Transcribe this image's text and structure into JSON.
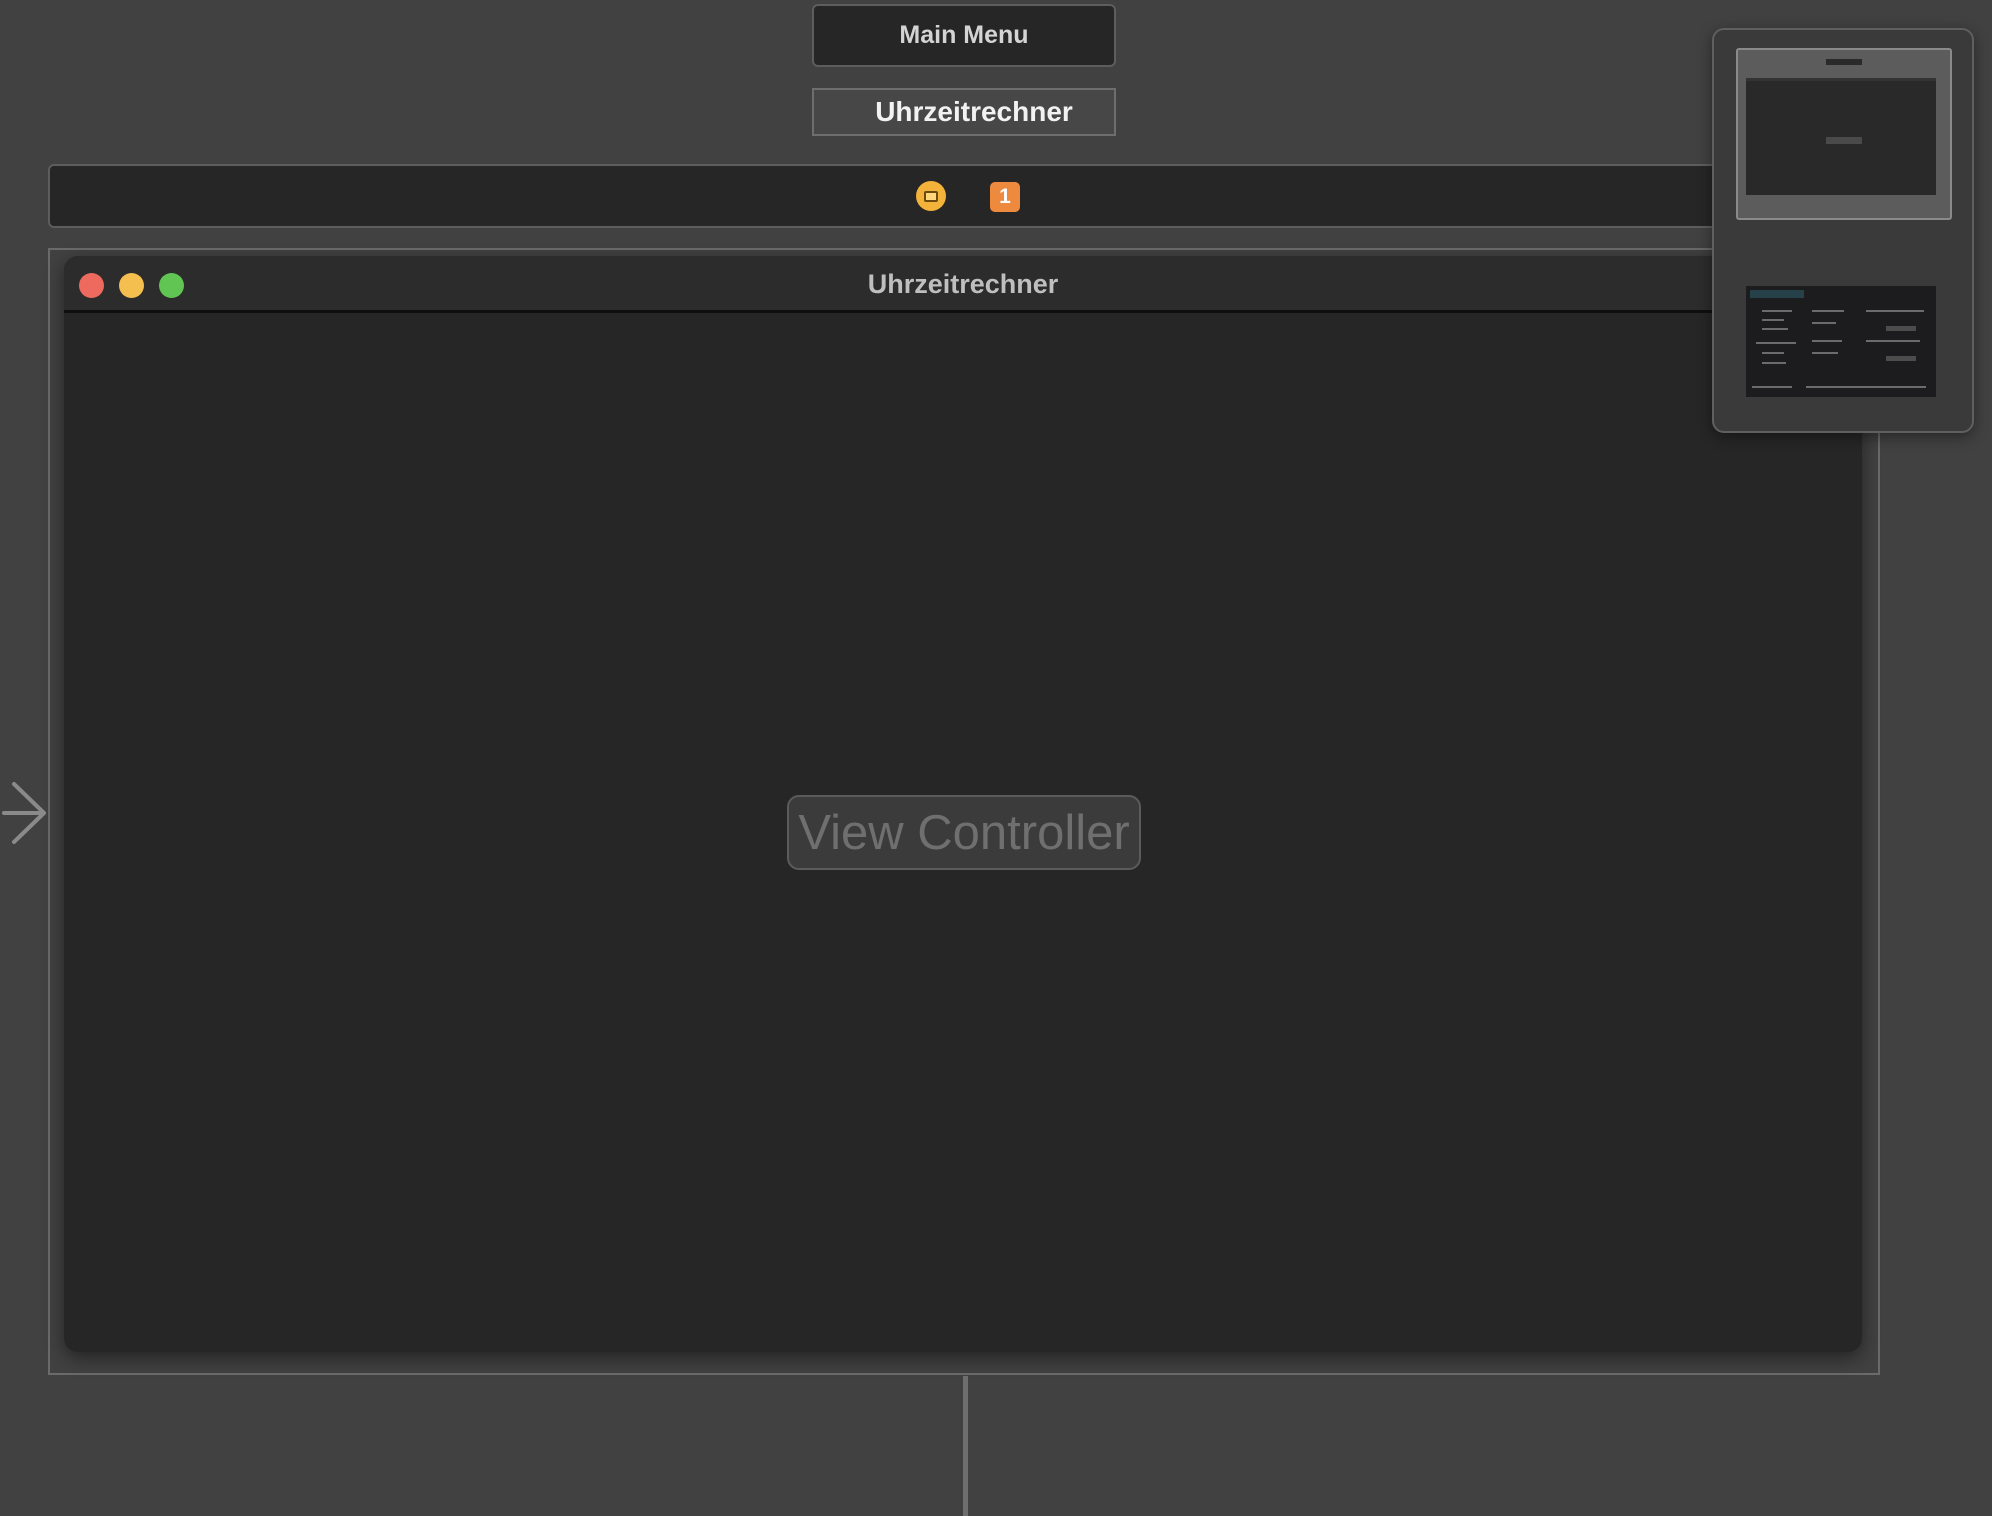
{
  "canvas": {
    "main_menu_label": "Main Menu",
    "scene_title": "Uhrzeitrechner",
    "dock": {
      "window_controller_icon": "window-controller-icon",
      "first_responder_badge": "1"
    }
  },
  "window": {
    "title": "Uhrzeitrechner",
    "traffic_lights": {
      "close_color": "#ee6a5e",
      "minimize_color": "#f5bf4f",
      "zoom_color": "#61c554"
    },
    "content_placeholder": "View Controller"
  },
  "minimap": {
    "icon": "minimap-icon"
  },
  "icons": {
    "entry_point": "entry-point-arrow-icon"
  }
}
